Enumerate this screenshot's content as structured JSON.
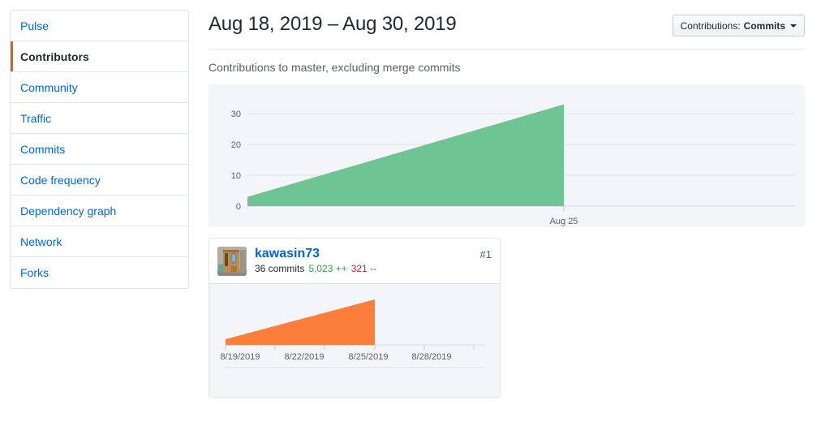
{
  "sidebar": {
    "items": [
      {
        "label": "Pulse",
        "selected": false
      },
      {
        "label": "Contributors",
        "selected": true
      },
      {
        "label": "Community",
        "selected": false
      },
      {
        "label": "Traffic",
        "selected": false
      },
      {
        "label": "Commits",
        "selected": false
      },
      {
        "label": "Code frequency",
        "selected": false
      },
      {
        "label": "Dependency graph",
        "selected": false
      },
      {
        "label": "Network",
        "selected": false
      },
      {
        "label": "Forks",
        "selected": false
      }
    ]
  },
  "header": {
    "title": "Aug 18, 2019 – Aug 30, 2019",
    "dropdown": {
      "label": "Contributions:",
      "value": "Commits",
      "caret_icon": "chevron-down-icon"
    }
  },
  "subtitle": "Contributions to master, excluding merge commits",
  "colors": {
    "green_area": "#6fc493",
    "orange_area": "#fb7e3a",
    "panel_bg": "#f3f5f8",
    "link_blue": "#0366d6",
    "accent_orange": "#e36209",
    "additions_green": "#28a745",
    "deletions_red": "#cb2431",
    "muted_gray": "#586069"
  },
  "contributor": {
    "rank": "#1",
    "username": "kawasin73",
    "commits": "36 commits",
    "additions": "5,023 ++",
    "deletions": "321 --",
    "avatar_icon": "avatar-photo-door"
  },
  "chart_data": [
    {
      "id": "overall-contributions",
      "type": "area",
      "title": "Contributions to master, excluding merge commits",
      "xlabel": "",
      "ylabel": "",
      "ylim": [
        0,
        35
      ],
      "yticks": [
        0,
        10,
        20,
        30
      ],
      "ytick_labels": [
        "0",
        "10",
        "20",
        "30"
      ],
      "xtick_labels": [
        "Aug 25"
      ],
      "grid": true,
      "legend": "none",
      "color": "#6fc493",
      "x": [
        "Aug 18",
        "Aug 25"
      ],
      "values": [
        3,
        33
      ],
      "note": "cumulative commits rising linearly from 3 to 33 between Aug 18 and Aug 25"
    },
    {
      "id": "kawasin73-sparkline",
      "type": "area",
      "title": "kawasin73",
      "xlabel": "",
      "ylabel": "",
      "ylim": [
        0,
        36
      ],
      "yticks": [],
      "ytick_labels": [],
      "xtick_labels": [
        "8/19/2019",
        "8/22/2019",
        "8/25/2019",
        "8/28/2019"
      ],
      "grid": true,
      "legend": "none",
      "color": "#fb7e3a",
      "x": [
        "8/19/2019",
        "8/25/2019"
      ],
      "values": [
        3,
        36
      ],
      "note": "commits rising linearly from 3 to 36 between 8/19/2019 and 8/25/2019"
    }
  ]
}
